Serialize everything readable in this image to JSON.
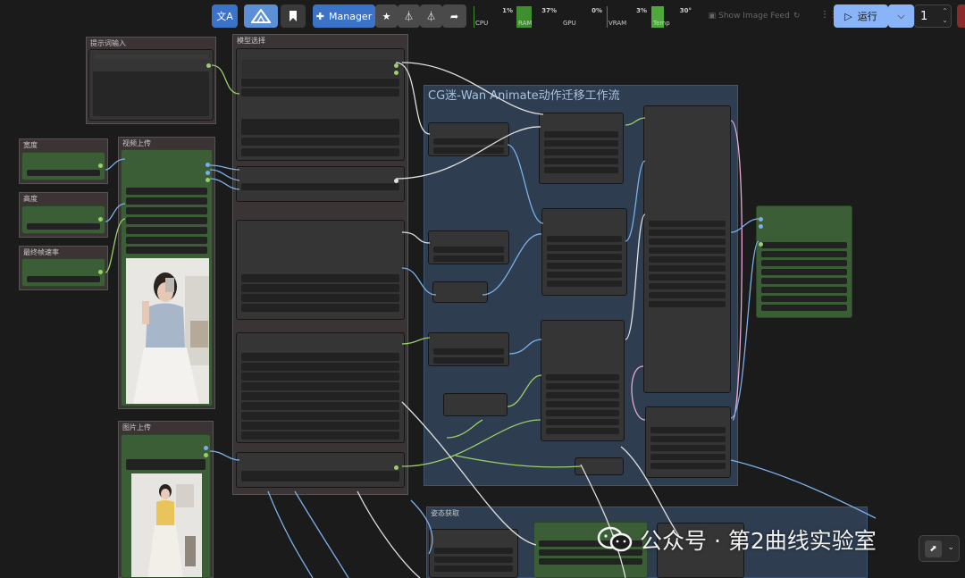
{
  "toolbar": {
    "translate_icon": "translate-icon",
    "logo_icon": "comfy-logo-icon",
    "bookmark_icon": "bookmark-icon",
    "manager_label": "Manager",
    "meters": [
      {
        "label": "CPU",
        "value": "1%",
        "level": 0.01
      },
      {
        "label": "RAM",
        "value": "37%",
        "level": 0.37
      },
      {
        "label": "GPU",
        "value": "0%",
        "level": 0.0
      },
      {
        "label": "VRAM",
        "value": "3%",
        "level": 0.03
      },
      {
        "label": "Temp",
        "value": "30°",
        "level": 0.3
      }
    ],
    "image_feed_label": "Show Image Feed",
    "run_label": "运行",
    "batch_count": "1",
    "accent_color": "#3a73c8",
    "run_color": "#8ab4f8"
  },
  "groups": {
    "prompt_input": "提示词输入",
    "model_select": "模型选择",
    "workflow": "CG迷-Wan Animate动作迁移工作流",
    "width": "宽度",
    "video_upload": "视频上传",
    "height": "高度",
    "fps": "最终帧速率",
    "image_upload": "图片上传",
    "pose": "姿态获取"
  },
  "watermark": "公众号 · 第2曲线实验室"
}
